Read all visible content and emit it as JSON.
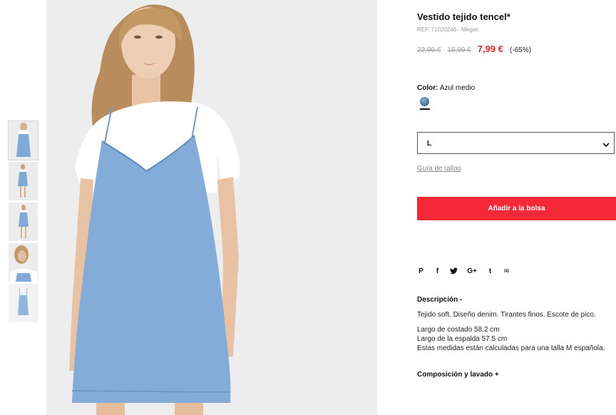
{
  "product": {
    "title": "Vestido tejido tencel*",
    "ref": "REF. 71020246 - Megan",
    "price_original": "22,99 €",
    "price_previous": "15,99 €",
    "price_current": "7,99 €",
    "discount": "(-65%)"
  },
  "color": {
    "label": "Color:",
    "value": "Azul medio",
    "swatch_hex": "#4f7aa3"
  },
  "size": {
    "selected": "L"
  },
  "size_guide": "Guía de tallas",
  "add_to_bag": "Añadir a la bolsa",
  "share_icons": [
    "pinterest-icon",
    "facebook-icon",
    "twitter-icon",
    "google-plus-icon",
    "tumblr-icon",
    "email-icon"
  ],
  "share_glyphs": [
    "P",
    "f",
    "t",
    "G+",
    "t",
    "✉"
  ],
  "description": {
    "title": "Descripción  -",
    "lines": [
      "Tejido soft. Diseño denim. Tirantes finos. Escote de pico.",
      "Largo de costado 58.2 cm",
      "Largo de la espalda 57.5 cm",
      "Estas medidas están calculadas para una talla M española."
    ]
  },
  "composition_title": "Composición y lavado  +",
  "colors": {
    "accent": "#f42837",
    "price": "#e3242b",
    "denim": "#7fa9d6",
    "background": "#ededed"
  }
}
